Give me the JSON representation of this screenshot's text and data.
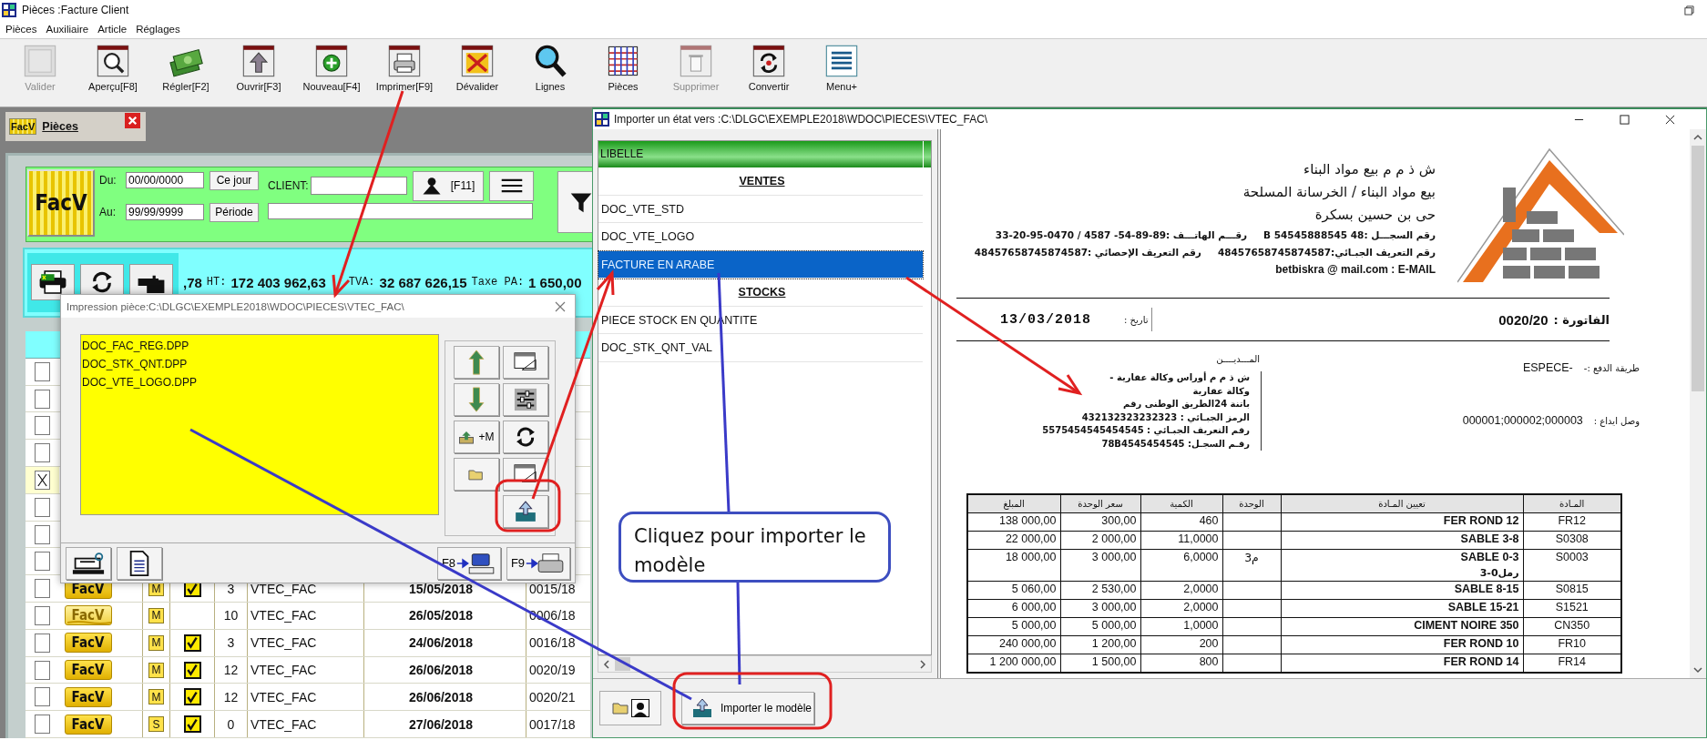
{
  "window": {
    "title": "Pièces :Facture Client"
  },
  "menu": [
    "Pièces",
    "Auxiliaire",
    "Article",
    "Réglages"
  ],
  "toolbar": [
    {
      "label": "Valider",
      "disabled": true
    },
    {
      "label": "Aperçu[F8]",
      "disabled": false
    },
    {
      "label": "Régler[F2]",
      "disabled": false
    },
    {
      "label": "Ouvrir[F3]",
      "disabled": false
    },
    {
      "label": "Nouveau[F4]",
      "disabled": false
    },
    {
      "label": "Imprimer[F9]",
      "disabled": false
    },
    {
      "label": "Dévalider",
      "disabled": false
    },
    {
      "label": "Lignes",
      "disabled": false
    },
    {
      "label": "Pièces",
      "disabled": false
    },
    {
      "label": "Supprimer",
      "disabled": true
    },
    {
      "label": "Convertir",
      "disabled": false
    },
    {
      "label": "Menu+",
      "disabled": false
    }
  ],
  "pieces_window": {
    "tab_badge": "FacV",
    "title": "Pièces",
    "filter": {
      "logo": "FacV",
      "from_label": "Du:",
      "from": "00/00/0000",
      "today_button": "Ce jour",
      "to_label": "Au:",
      "to": "99/99/9999",
      "period_button": "Période",
      "client_label": "CLIENT:",
      "client_button": "[F11]"
    },
    "totals_lead": ",78",
    "totals": [
      {
        "label": "HT:",
        "value": "172 403 962,63"
      },
      {
        "label": "TVA:",
        "value": "32 687 626,15"
      },
      {
        "label": "Taxe PA:",
        "value": "1 650,00"
      }
    ],
    "rows": [
      {
        "checked": false
      },
      {
        "checked": false
      },
      {
        "checked": false
      },
      {
        "checked": false
      },
      {
        "checked": true
      },
      {
        "checked": false
      },
      {
        "checked": false
      },
      {
        "checked": false
      },
      {
        "checked": false,
        "badge": "FacV",
        "cancelled": false,
        "mode": "M",
        "validated": true,
        "count": "3",
        "journal": "VTEC_FAC",
        "date": "15/05/2018",
        "number": "0015/18"
      },
      {
        "checked": false,
        "badge": "FacV",
        "cancelled": true,
        "mode": "M",
        "validated": false,
        "count": "10",
        "journal": "VTEC_FAC",
        "date": "26/05/2018",
        "number": "0006/18"
      },
      {
        "checked": false,
        "badge": "FacV",
        "cancelled": false,
        "mode": "M",
        "validated": true,
        "count": "3",
        "journal": "VTEC_FAC",
        "date": "24/06/2018",
        "number": "0016/18"
      },
      {
        "checked": false,
        "badge": "FacV",
        "cancelled": false,
        "mode": "M",
        "validated": true,
        "count": "12",
        "journal": "VTEC_FAC",
        "date": "26/06/2018",
        "number": "0020/19"
      },
      {
        "checked": false,
        "badge": "FacV",
        "cancelled": false,
        "mode": "M",
        "validated": true,
        "count": "12",
        "journal": "VTEC_FAC",
        "date": "26/06/2018",
        "number": "0020/21"
      },
      {
        "checked": false,
        "badge": "FacV",
        "cancelled": false,
        "mode": "S",
        "validated": true,
        "count": "0",
        "journal": "VTEC_FAC",
        "date": "27/06/2018",
        "number": "0017/18"
      }
    ]
  },
  "print_dialog": {
    "title": "Impression pièce:C:\\DLGC\\EXEMPLE2018\\WDOC\\PIECES\\VTEC_FAC\\",
    "files": [
      "DOC_FAC_REG.DPP",
      "DOC_STK_QNT.DPP",
      "DOC_VTE_LOGO.DPP"
    ],
    "add_button": "+M",
    "preview_key": "F8",
    "print_key": "F9"
  },
  "import_dialog": {
    "title": "Importer un état vers :C:\\DLGC\\EXEMPLE2018\\WDOC\\PIECES\\VTEC_FAC\\",
    "column": "LIBELLE",
    "items": [
      {
        "kind": "group",
        "label": "VENTES",
        "selected": false
      },
      {
        "kind": "item",
        "label": "DOC_VTE_STD",
        "selected": false
      },
      {
        "kind": "item",
        "label": "DOC_VTE_LOGO",
        "selected": false
      },
      {
        "kind": "item",
        "label": "FACTURE EN ARABE",
        "selected": true
      },
      {
        "kind": "group",
        "label": "STOCKS",
        "selected": false
      },
      {
        "kind": "item",
        "label": "PIECE STOCK EN QUANTITE",
        "selected": false
      },
      {
        "kind": "item",
        "label": "DOC_STK_QNT_VAL",
        "selected": false
      }
    ],
    "import_button": "Importer le modèle",
    "invoice": {
      "company_lines": [
        "ش ذ م م   بيع مواد البناء",
        "بيع مواد البناء / الخرسانة المسلحة",
        "حى بن حسين بسكرة"
      ],
      "info_lines": [
        [
          "رقم السجـــل :48 B 54545888545",
          "رقـــم الهاتـــف :89-89-54- 4587 / 0470-95-20-33"
        ],
        [
          "رقم التعريف الجبـائي:48457658745874587",
          "رقم التعريف الإحصائي :48457658745874587"
        ]
      ],
      "email": "betbiskra @ mail.com : E-MAIL",
      "invoice_label": "الفاتورة :",
      "invoice_number": "0020/20",
      "date_label": "تاريخ :",
      "date": "13/03/2018",
      "debtor_label": "المـــديــــن",
      "debtor_lines": [
        "ش ذ م م أوراس وكالة عقارية  -",
        "وكالة عقارية",
        "باتنة 24الطريق الوطنى رقم",
        "الرمز الجبـائي : 432132323232323",
        "رقم التعريف الجبـائي : 5575454545454545",
        "رقـم السجـل: 78B4545454545"
      ],
      "payment_label": "طريقة الدفع :-",
      "payment": "ESPECE-",
      "deposit_label": "وصل ايداع :",
      "deposit": "000001;000002;000003",
      "columns": [
        "المـادة",
        "تعيين المـادة",
        "الوحدة",
        "الكمية",
        "سعر الوحدة",
        "المبلغ"
      ],
      "rows": [
        {
          "code": "FR12",
          "designation": "FER ROND 12",
          "quantity": "460",
          "unit_price": "300,00",
          "amount": "138 000,00"
        },
        {
          "code": "S0308",
          "designation": "SABLE 3-8",
          "quantity": "11,0000",
          "unit_price": "2 000,00",
          "amount": "22 000,00"
        },
        {
          "code": "S0003",
          "designation": "SABLE 0-3",
          "designation_note": "رمل0-3",
          "unit": "م3",
          "quantity": "6,0000",
          "unit_price": "3 000,00",
          "amount": "18 000,00"
        },
        {
          "code": "S0815",
          "designation": "SABLE 8-15",
          "quantity": "2,0000",
          "unit_price": "2 530,00",
          "amount": "5 060,00"
        },
        {
          "code": "S1521",
          "designation": "SABLE 15-21",
          "quantity": "2,0000",
          "unit_price": "3 000,00",
          "amount": "6 000,00"
        },
        {
          "code": "CN350",
          "designation": "CIMENT NOIRE 350",
          "quantity": "1,0000",
          "unit_price": "5 000,00",
          "amount": "5 000,00"
        },
        {
          "code": "FR10",
          "designation": "FER ROND 10",
          "quantity": "200",
          "unit_price": "1 200,00",
          "amount": "240 000,00"
        },
        {
          "code": "FR14",
          "designation": "FER ROND 14",
          "quantity": "800",
          "unit_price": "1 500,00",
          "amount": "1 200 000,00"
        }
      ]
    }
  },
  "annotation": {
    "callout": "Cliquez pour importer le modèle"
  }
}
